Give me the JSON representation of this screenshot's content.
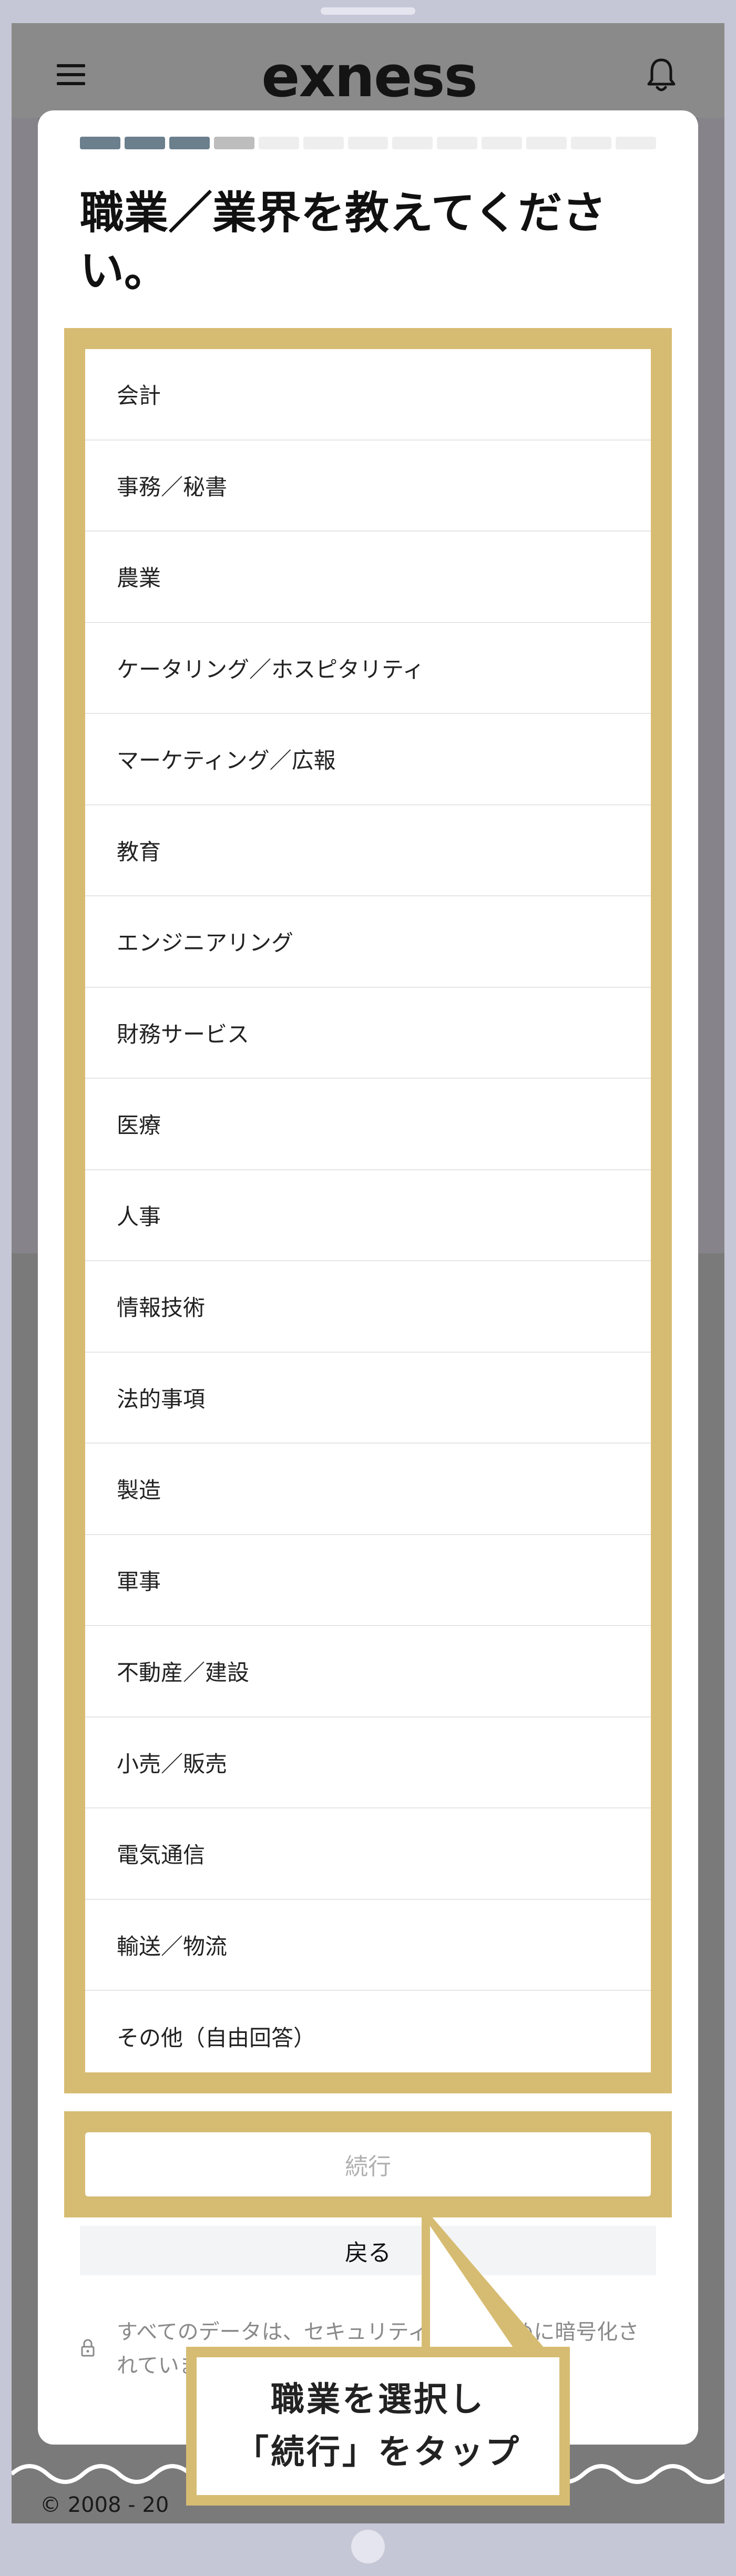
{
  "header": {
    "logo_text": "exness",
    "menu_icon": "hamburger-icon",
    "notifications_icon": "bell-icon"
  },
  "progress": {
    "total_steps": 13,
    "completed_steps": 3,
    "current_step": 4
  },
  "title": "職業／業界を教えてください。",
  "options": [
    "会計",
    "事務／秘書",
    "農業",
    "ケータリング／ホスピタリティ",
    "マーケティング／広報",
    "教育",
    "エンジニアリング",
    "財務サービス",
    "医療",
    "人事",
    "情報技術",
    "法的事項",
    "製造",
    "軍事",
    "不動産／建設",
    "小売／販売",
    "電気通信",
    "輸送／物流",
    "その他（自由回答）"
  ],
  "buttons": {
    "continue": "続行",
    "back": "戻る"
  },
  "security_note": "すべてのデータは、セキュリティ対策のために暗号化されています",
  "callout": {
    "line1": "職業を選択し",
    "line2": "「続行」をタップ"
  },
  "footer": {
    "copyright": "© 2008 - 20"
  },
  "colors": {
    "highlight": "#d6bc72",
    "progress_done": "#6b7f8d",
    "progress_current": "#bdbdbd",
    "progress_empty": "#eeeeee",
    "overlay": "#7a7a7a",
    "device_frame": "#c6c7d6"
  }
}
